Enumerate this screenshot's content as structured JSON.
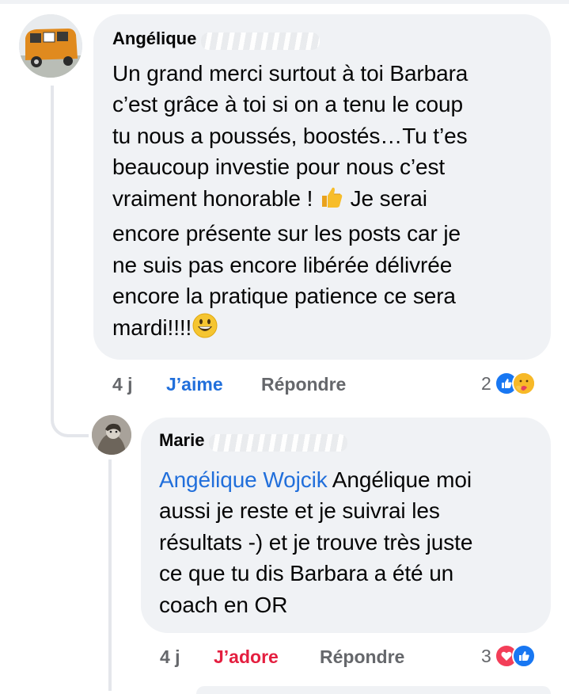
{
  "comments": [
    {
      "author": "Angélique",
      "text": "Un grand merci surtout à toi Barbara\nc’est grâce à toi si on a tenu le coup\ntu nous a poussés, boostés…Tu t’es\nbeaucoup investie pour nous c’est\nvraiment honorable !",
      "text_after_thumb": " Je serai\nencore présente  sur les posts car je\nne suis pas encore libérée délivrée\nencore la pratique patience ce sera\nmardi!!!!",
      "time": "4 j",
      "like_label": "J’aime",
      "reply_label": "Répondre",
      "reaction_count": "2",
      "reactions": [
        "like-icon",
        "care-icon"
      ]
    },
    {
      "author": "Marie",
      "mention": "Angélique Wojcik",
      "text": " Angélique moi\naussi je reste et je suivrai les\nrésultats -) et je trouve très juste\nce que tu dis Barbara a été un\ncoach en OR",
      "time": "4 j",
      "like_label": "J’adore",
      "reply_label": "Répondre",
      "reaction_count": "3",
      "reactions": [
        "love-icon",
        "like-icon"
      ]
    }
  ],
  "colors": {
    "bubble": "#f0f2f5",
    "link_blue": "#216fdb",
    "love_red": "#e41e3f",
    "meta_gray": "#65676b"
  }
}
